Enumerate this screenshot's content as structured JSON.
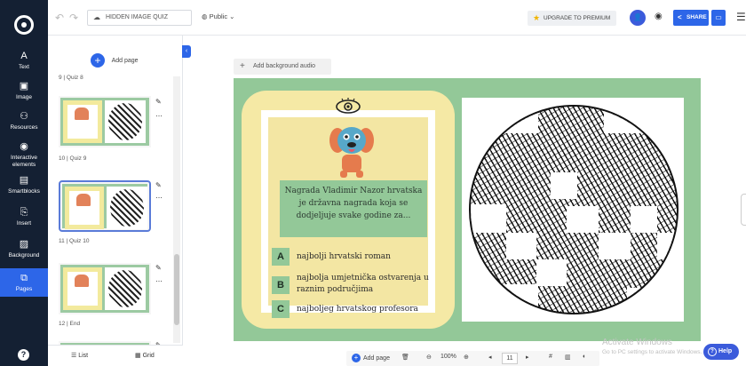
{
  "app": {
    "accent": "#2d66e8",
    "rail_color": "#142033"
  },
  "rail": {
    "items": [
      {
        "label": "Text",
        "icon": "text-icon"
      },
      {
        "label": "Image",
        "icon": "image-icon"
      },
      {
        "label": "Resources",
        "icon": "resources-icon"
      },
      {
        "label": "Interactive elements",
        "icon": "interactive-icon"
      },
      {
        "label": "Smartblocks",
        "icon": "smartblocks-icon"
      },
      {
        "label": "Insert",
        "icon": "insert-icon"
      },
      {
        "label": "Background",
        "icon": "background-icon"
      },
      {
        "label": "Pages",
        "icon": "pages-icon"
      }
    ]
  },
  "topbar": {
    "title": "HIDDEN IMAGE QUIZ",
    "visibility": "Public",
    "upgrade": "UPGRADE TO PREMIUM",
    "share": "SHARE"
  },
  "panel": {
    "add_page": "Add page",
    "top_label": "9 | Quiz 8",
    "slides": [
      {
        "label": "10 | Quiz 9"
      },
      {
        "label": "11 | Quiz 10"
      },
      {
        "label": "12 | End"
      }
    ],
    "list": "List",
    "grid": "Grid"
  },
  "canvas": {
    "bg_audio": "Add background audio",
    "question": "Nagrada Vladimir Nazor hrvatska je državna nagrada koja se dodjeljuje svake godine za...",
    "answers": [
      {
        "letter": "A",
        "text": "najbolji hrvatski roman"
      },
      {
        "letter": "B",
        "text": "najbolja umjetnička ostvarenja u raznim područjima"
      },
      {
        "letter": "C",
        "text": "najboljeg hrvatskog profesora"
      }
    ],
    "colors": {
      "slide_bg": "#93c898",
      "card_bg": "#f5e9a5"
    }
  },
  "bottombar": {
    "add_page": "Add page",
    "zoom": "100%",
    "page": "11"
  },
  "watermark": {
    "line1": "Activate Windows",
    "line2": "Go to PC settings to activate Windows."
  },
  "help": "Help"
}
